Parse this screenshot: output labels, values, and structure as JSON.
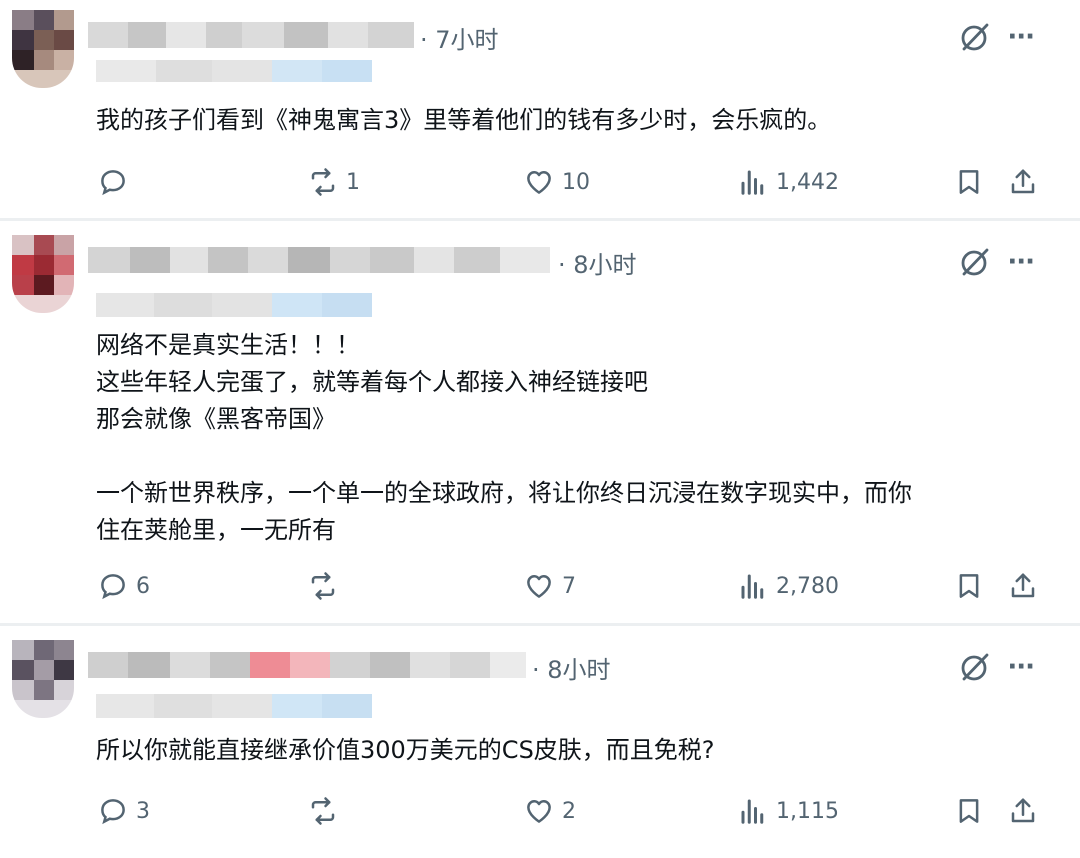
{
  "posts": [
    {
      "time": "· 7小时",
      "text": "我的孩子们看到《神鬼寓言3》里等着他们的钱有多少时，会乐疯的。",
      "stats": {
        "replies": "",
        "reposts": "1",
        "likes": "10",
        "views": "1,442"
      },
      "more": "···"
    },
    {
      "time": "· 8小时",
      "text": "网络不是真实生活！！！\n这些年轻人完蛋了，就等着每个人都接入神经链接吧\n那会就像《黑客帝国》\n\n一个新世界秩序，一个单一的全球政府，将让你终日沉浸在数字现实中，而你\n住在荚舱里，一无所有",
      "stats": {
        "replies": "6",
        "reposts": "",
        "likes": "7",
        "views": "2,780"
      },
      "more": "···"
    },
    {
      "time": "· 8小时",
      "text": "所以你就能直接继承价值300万美元的CS皮肤，而且免税?",
      "stats": {
        "replies": "3",
        "reposts": "",
        "likes": "2",
        "views": "1,115"
      },
      "more": "···"
    }
  ],
  "icons": {
    "reply": "reply-icon",
    "repost": "repost-icon",
    "like": "heart-icon",
    "views": "views-icon",
    "bookmark": "bookmark-icon",
    "share": "share-icon",
    "grok": "grok-icon",
    "more": "more-icon"
  },
  "colors": {
    "meta": "#536471",
    "text": "#0f1419",
    "divider": "#eceff1"
  }
}
